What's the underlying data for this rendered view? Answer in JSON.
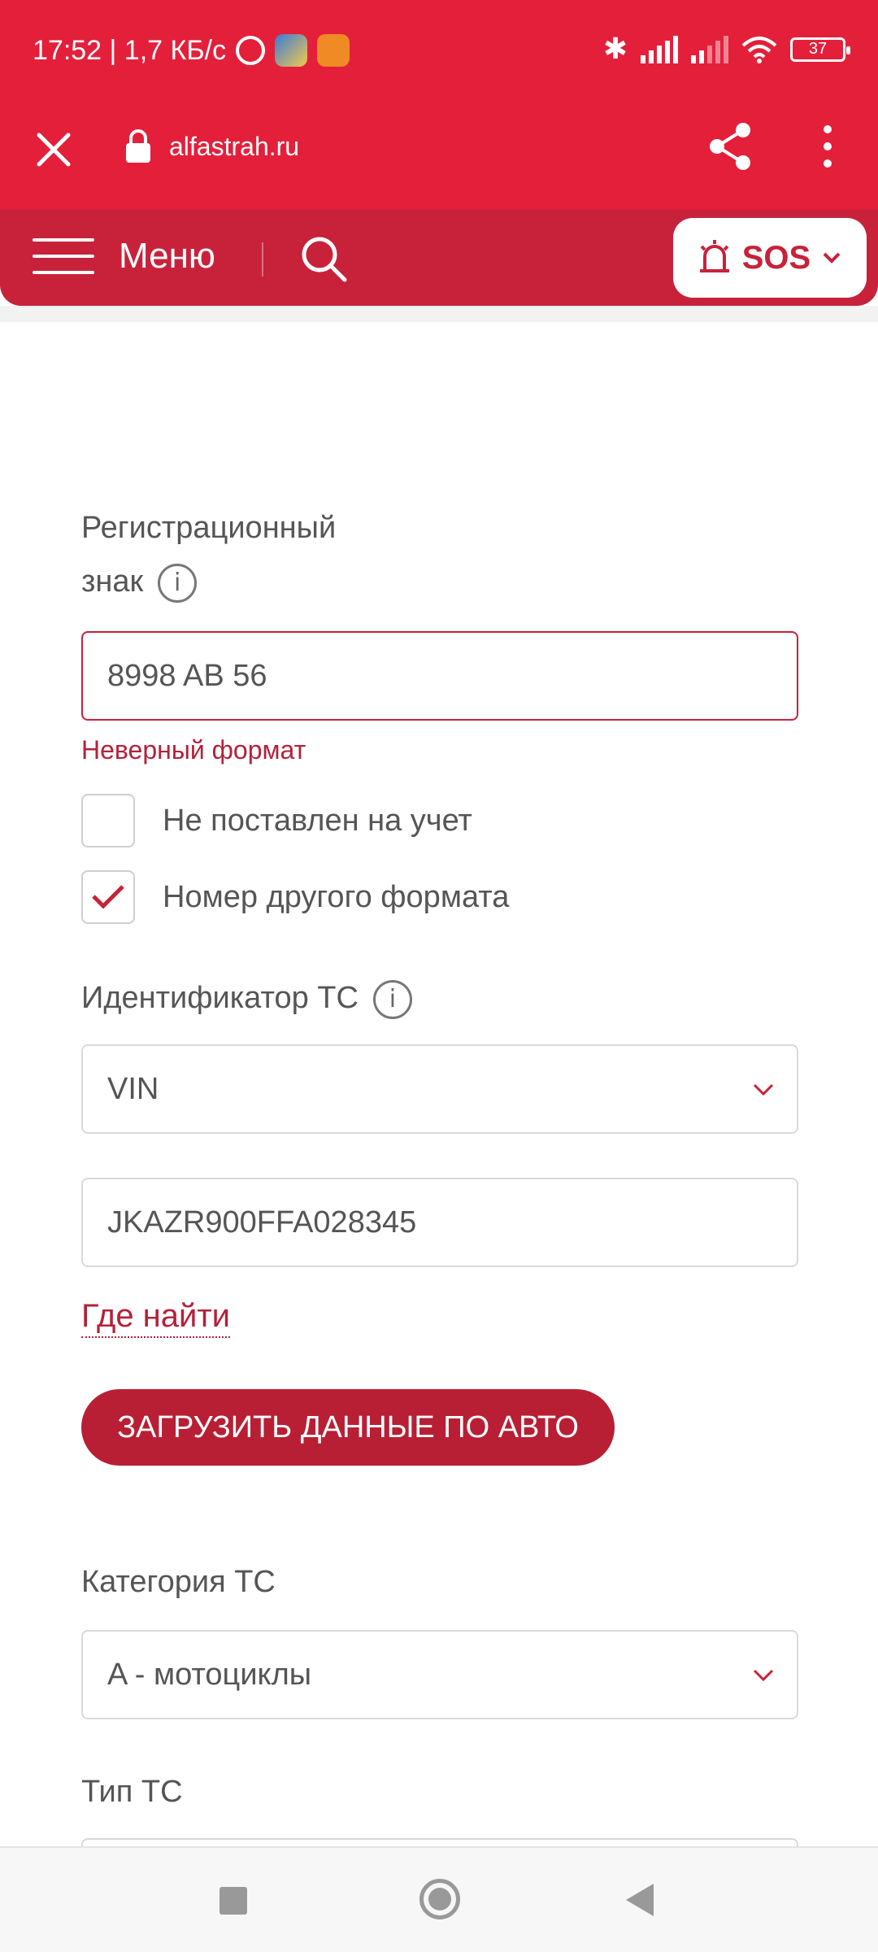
{
  "status_bar": {
    "time_speed": "17:52 | 1,7 КБ/с",
    "battery": "37",
    "icons": [
      "alarm-icon",
      "weather-app-icon",
      "app-icon",
      "bluetooth-icon",
      "signal-icon",
      "signal-icon",
      "wifi-icon",
      "battery-icon"
    ]
  },
  "browser": {
    "url": "alfastrah.ru"
  },
  "header": {
    "menu_label": "Меню",
    "sos_label": "SOS",
    "accent": "#c8223a"
  },
  "form": {
    "reg_label_line1": "Регистрационный",
    "reg_label_line2": "знак",
    "reg_value": "8998 AB 56",
    "reg_error": "Неверный формат",
    "checkbox_not_registered": {
      "label": "Не поставлен на учет",
      "checked": false
    },
    "checkbox_other_format": {
      "label": "Номер другого формата",
      "checked": true
    },
    "id_label": "Идентификатор ТС",
    "id_select_value": "VIN",
    "vin_value": "JKAZR900FFA028345",
    "where_link": "Где найти",
    "load_button": "ЗАГРУЗИТЬ ДАННЫЕ ПО АВТО",
    "category_label": "Категория ТС",
    "category_value": "A - мотоциклы",
    "type_label": "Тип ТС"
  },
  "info_icon_glyph": "i"
}
